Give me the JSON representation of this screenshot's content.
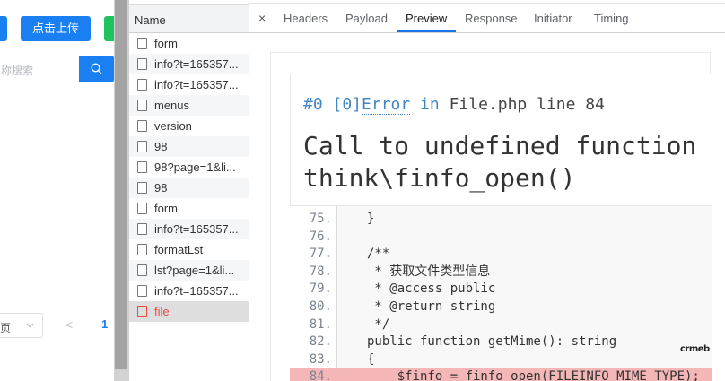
{
  "app": {
    "upload_button": "点击上传",
    "search_placeholder": "称搜索",
    "pager_select_text": "页",
    "pager_prev": "<",
    "pager_current": "1"
  },
  "network": {
    "header": "Name",
    "rows": [
      {
        "name": "form",
        "status": "ok"
      },
      {
        "name": "info?t=165357...",
        "status": "ok"
      },
      {
        "name": "info?t=165357...",
        "status": "ok"
      },
      {
        "name": "menus",
        "status": "ok"
      },
      {
        "name": "version",
        "status": "ok"
      },
      {
        "name": "98",
        "status": "ok"
      },
      {
        "name": "98?page=1&li...",
        "status": "ok"
      },
      {
        "name": "98",
        "status": "ok"
      },
      {
        "name": "form",
        "status": "ok"
      },
      {
        "name": "info?t=165357...",
        "status": "ok"
      },
      {
        "name": "formatLst",
        "status": "ok"
      },
      {
        "name": "lst?page=1&li...",
        "status": "ok"
      },
      {
        "name": "info?t=165357...",
        "status": "ok"
      },
      {
        "name": "file",
        "status": "error"
      }
    ]
  },
  "detail": {
    "close": "×",
    "tabs": [
      "Headers",
      "Payload",
      "Preview",
      "Response",
      "Initiator",
      "Timing"
    ],
    "active_tab": "Preview"
  },
  "error": {
    "index": "#0 [0]",
    "type": "Error",
    "in": " in ",
    "file": "File.php line 84",
    "message_line1": "Call to undefined function",
    "message_line2": "think\\finfo_open()"
  },
  "code": [
    {
      "n": "75.",
      "src": "}"
    },
    {
      "n": "76.",
      "src": ""
    },
    {
      "n": "77.",
      "src": "/**"
    },
    {
      "n": "78.",
      "src": " * 获取文件类型信息"
    },
    {
      "n": "79.",
      "src": " * @access public"
    },
    {
      "n": "80.",
      "src": " * @return string"
    },
    {
      "n": "81.",
      "src": " */"
    },
    {
      "n": "82.",
      "src": "public function getMime(): string"
    },
    {
      "n": "83.",
      "src": "{"
    },
    {
      "n": "84.",
      "src": "    $finfo = finfo_open(FILEINFO_MIME_TYPE);",
      "highlight": true
    }
  ],
  "watermark": "crmeb",
  "colors": {
    "primary": "#1a7ff0",
    "success": "#1ec35b",
    "devtools_accent": "#1a73e8",
    "error_red": "#e84c3d",
    "error_line_bg": "#f4b6b6"
  }
}
